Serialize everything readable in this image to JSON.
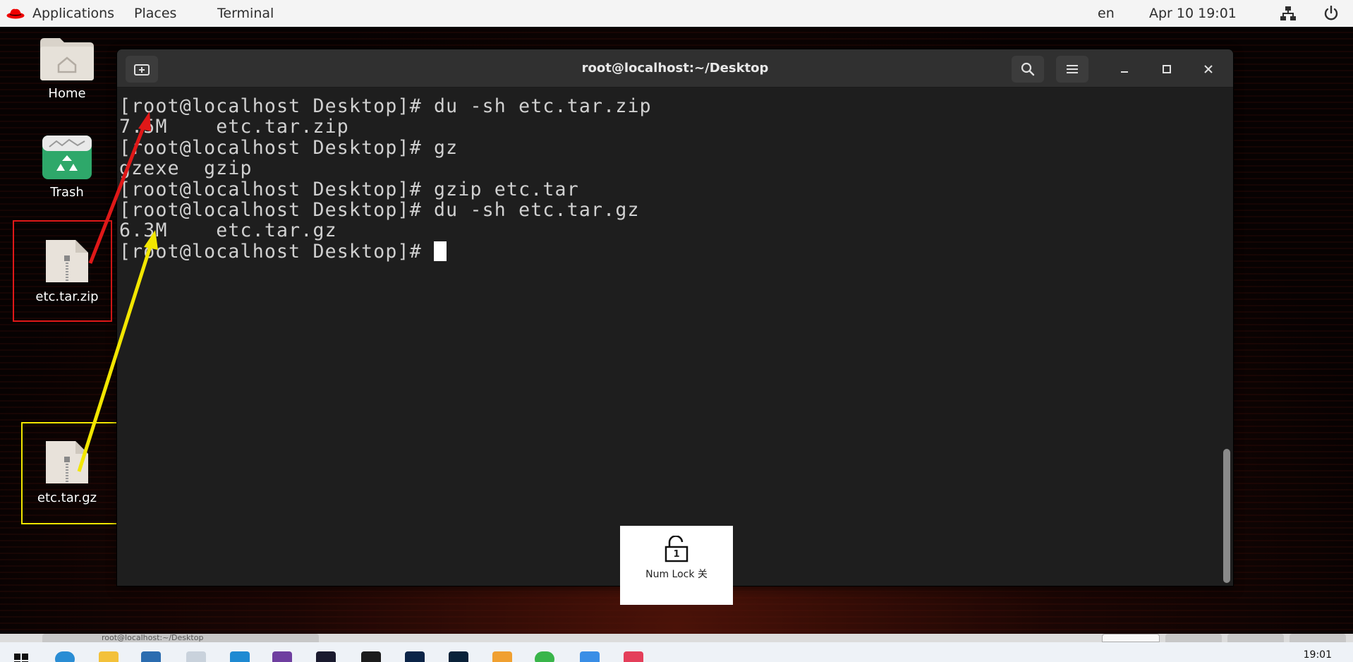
{
  "topbar": {
    "applications": "Applications",
    "places": "Places",
    "terminal": "Terminal",
    "lang": "en",
    "datetime": "Apr 10  19:01"
  },
  "desktop": {
    "home_label": "Home",
    "trash_label": "Trash",
    "zip_label": "etc.tar.zip",
    "gz_label": "etc.tar.gz"
  },
  "window": {
    "title": "root@localhost:~/Desktop"
  },
  "terminal": {
    "lines": [
      "[root@localhost Desktop]# du -sh etc.tar.zip",
      "7.5M    etc.tar.zip",
      "[root@localhost Desktop]# gz",
      "gzexe  gzip",
      "[root@localhost Desktop]# gzip etc.tar",
      "[root@localhost Desktop]# du -sh etc.tar.gz",
      "6.3M    etc.tar.gz"
    ],
    "prompt": "[root@localhost Desktop]# "
  },
  "osd": {
    "lock_digit": "1",
    "text": "Num Lock 关"
  },
  "vm_tab": {
    "label": "root@localhost:~/Desktop"
  },
  "taskbar": {
    "time": "19:01"
  },
  "colors": {
    "terminal_bg": "#1e1e1e",
    "titlebar_bg": "#303030",
    "annotation_red": "#e01818",
    "annotation_yellow": "#f2e600",
    "trash_green": "#2ea86a"
  }
}
